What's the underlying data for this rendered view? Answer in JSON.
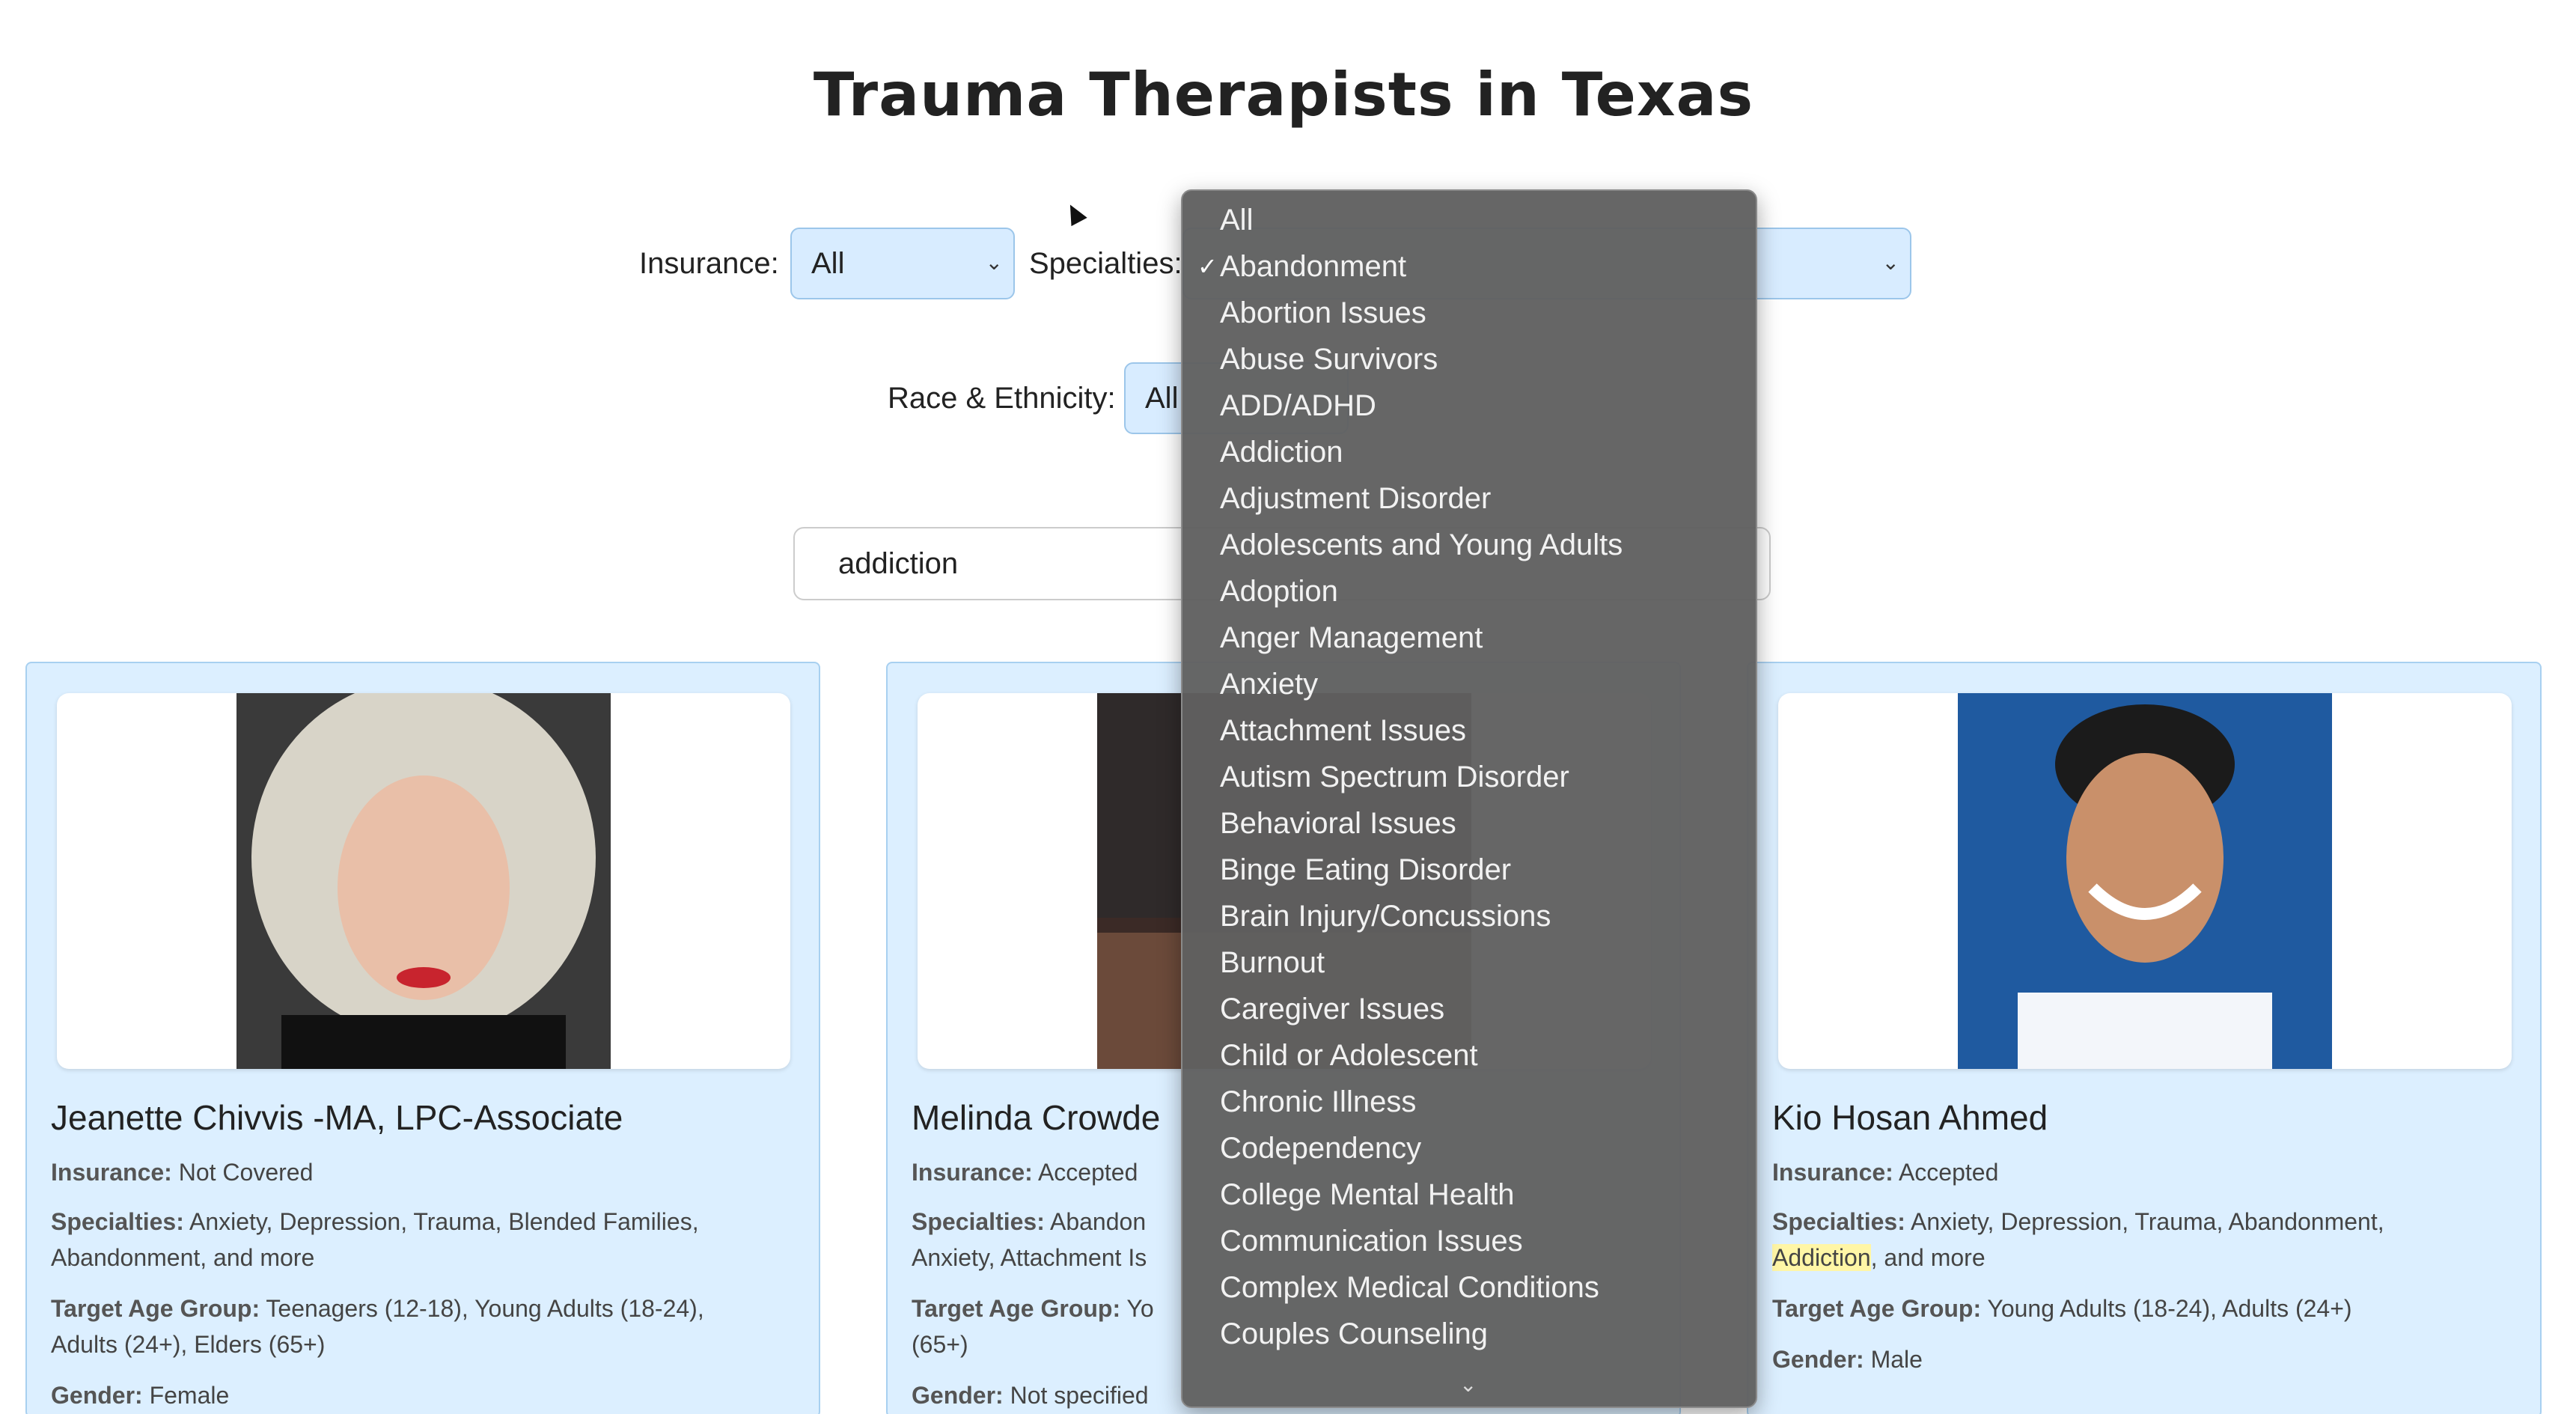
{
  "page": {
    "title": "Trauma Therapists in Texas"
  },
  "filters": {
    "insurance": {
      "label": "Insurance:",
      "value": "All"
    },
    "specialties": {
      "label": "Specialties:"
    },
    "race_ethnicity": {
      "label": "Race & Ethnicity:",
      "value": "All"
    }
  },
  "search": {
    "value": "addiction"
  },
  "dropdown": {
    "selected": "Abandonment",
    "options": [
      "All",
      "Abandonment",
      "Abortion Issues",
      "Abuse Survivors",
      "ADD/ADHD",
      "Addiction",
      "Adjustment Disorder",
      "Adolescents and Young Adults",
      "Adoption",
      "Anger Management",
      "Anxiety",
      "Attachment Issues",
      "Autism Spectrum Disorder",
      "Behavioral Issues",
      "Binge Eating Disorder",
      "Brain Injury/Concussions",
      "Burnout",
      "Caregiver Issues",
      "Child or Adolescent",
      "Chronic Illness",
      "Codependency",
      "College Mental Health",
      "Communication Issues",
      "Complex Medical Conditions",
      "Couples Counseling"
    ]
  },
  "cards": [
    {
      "name": "Jeanette Chivvis -MA, LPC-Associate",
      "insurance_label": "Insurance:",
      "insurance": "Not Covered",
      "specialties_label": "Specialties:",
      "specialties_line1": "Anxiety, Depression, Trauma, Blended Families,",
      "specialties_line2": "Abandonment, and more",
      "age_label": "Target Age Group:",
      "age_line1": "Teenagers (12-18), Young Adults (18-24),",
      "age_line2": "Adults (24+), Elders (65+)",
      "gender_label": "Gender:",
      "gender": "Female"
    },
    {
      "name": "Melinda Crowde",
      "insurance_label": "Insurance:",
      "insurance": "Accepted",
      "specialties_label": "Specialties:",
      "specialties_line1": "Abandon",
      "specialties_line2": "Anxiety, Attachment Is",
      "age_label": "Target Age Group:",
      "age_line1": "Yo",
      "age_line2": "(65+)",
      "gender_label": "Gender:",
      "gender": "Not specified"
    },
    {
      "name": "Kio Hosan Ahmed",
      "insurance_label": "Insurance:",
      "insurance": "Accepted",
      "specialties_label": "Specialties:",
      "specialties_line1": "Anxiety, Depression, Trauma, Abandonment,",
      "specialties_hl": "Addiction",
      "specialties_rest": ", and more",
      "age_label": "Target Age Group:",
      "age_line1": "Young Adults (18-24), Adults (24+)",
      "gender_label": "Gender:",
      "gender": "Male"
    }
  ],
  "colors": {
    "card_bg": "#dcefff",
    "select_bg": "#d8ecff",
    "dropdown_bg": "#606060",
    "highlight": "#fff6a6"
  }
}
